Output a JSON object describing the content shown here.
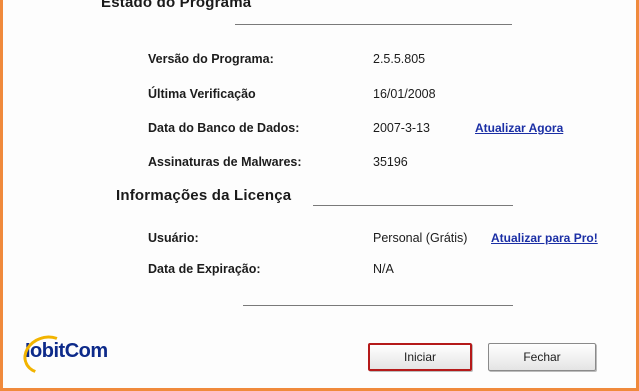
{
  "program_status": {
    "title": "Estado do Programa",
    "rows": [
      {
        "label": "Versão do Programa:",
        "value": "2.5.5.805"
      },
      {
        "label": "Última Verificação",
        "value": "16/01/2008"
      },
      {
        "label": "Data do Banco de Dados:",
        "value": "2007-3-13",
        "link": "Atualizar Agora"
      },
      {
        "label": "Assinaturas de Malwares:",
        "value": "35196"
      }
    ]
  },
  "license": {
    "title": "Informações da Licença",
    "rows": [
      {
        "label": "Usuário:",
        "value": "Personal (Grátis)",
        "link": "Atualizar para Pro!"
      },
      {
        "label": "Data de Expiração:",
        "value": "N/A"
      }
    ]
  },
  "brand": {
    "logo_text": "IobitCom"
  },
  "buttons": {
    "start": "Iniciar",
    "close": "Fechar"
  },
  "colors": {
    "frame": "#f08a3c",
    "link": "#1b2fa5",
    "primary_border": "#b51a1a",
    "logo": "#0d2a8a"
  }
}
